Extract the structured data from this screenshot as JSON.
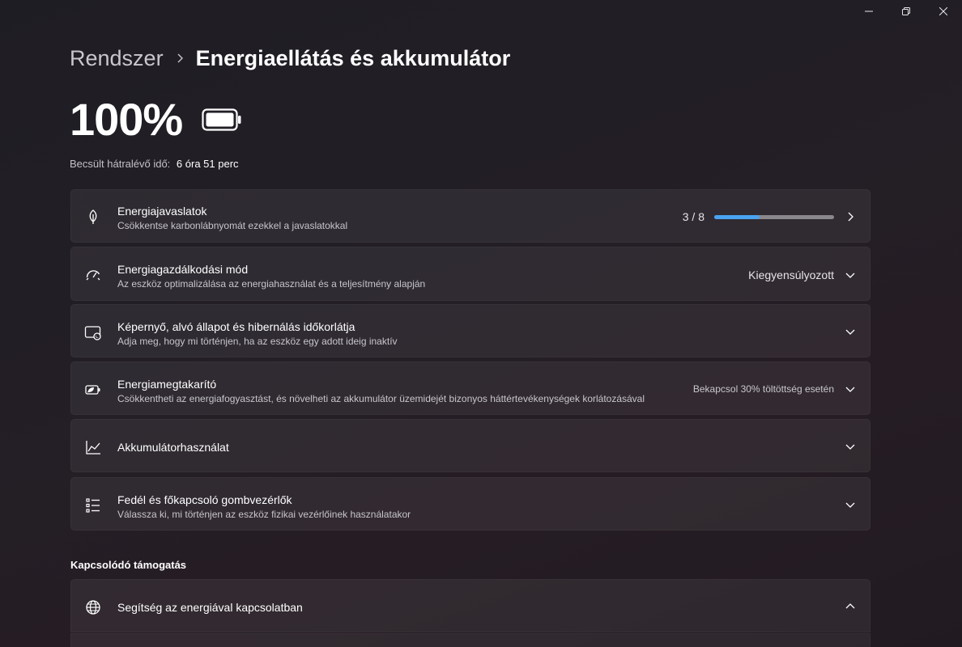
{
  "window": {
    "minimize_icon": "minimize-icon",
    "restore_icon": "restore-icon",
    "close_icon": "close-icon"
  },
  "breadcrumb": {
    "parent": "Rendszer",
    "current": "Energiaellátás és akkumulátor"
  },
  "battery": {
    "percent": "100%",
    "level": 1.0,
    "remaining_label": "Becsült hátralévő idő:",
    "remaining_value": "6 óra 51 perc"
  },
  "cards": {
    "recommendations": {
      "title": "Energiajavaslatok",
      "subtitle": "Csökkentse karbonlábnyomát ezekkel a javaslatokkal",
      "progress_label": "3 / 8",
      "progress": 0.375,
      "icon": "leaf-icon"
    },
    "power_mode": {
      "title": "Energiagazdálkodási mód",
      "subtitle": "Az eszköz optimalizálása az energiahasználat és a teljesítmény alapján",
      "value": "Kiegyensúlyozott",
      "icon": "gauge-icon"
    },
    "screen_sleep": {
      "title": "Képernyő, alvó állapot és hibernálás időkorlátja",
      "subtitle": "Adja meg, hogy mi történjen, ha az eszköz egy adott ideig inaktív",
      "icon": "screen-sleep-icon"
    },
    "energy_saver": {
      "title": "Energiamegtakarító",
      "subtitle": "Csökkentheti az energiafogyasztást, és növelheti az akkumulátor üzemidejét bizonyos háttértevékenységek korlátozásával",
      "value": "Bekapcsol 30% töltöttség esetén",
      "icon": "battery-saver-icon"
    },
    "battery_usage": {
      "title": "Akkumulátorhasználat",
      "icon": "chart-icon"
    },
    "lid_buttons": {
      "title": "Fedél és főkapcsoló gombvezérlők",
      "subtitle": "Válassza ki, mi történjen az eszköz fizikai vezérlőinek használatakor",
      "icon": "list-icon"
    }
  },
  "related_support": {
    "heading": "Kapcsolódó támogatás",
    "help_item": {
      "title": "Segítség az energiával kapcsolatban",
      "icon": "globe-icon"
    }
  },
  "colors": {
    "accent": "#4aa3f0",
    "card_bg": "#2c2830",
    "background": "#221e25"
  }
}
